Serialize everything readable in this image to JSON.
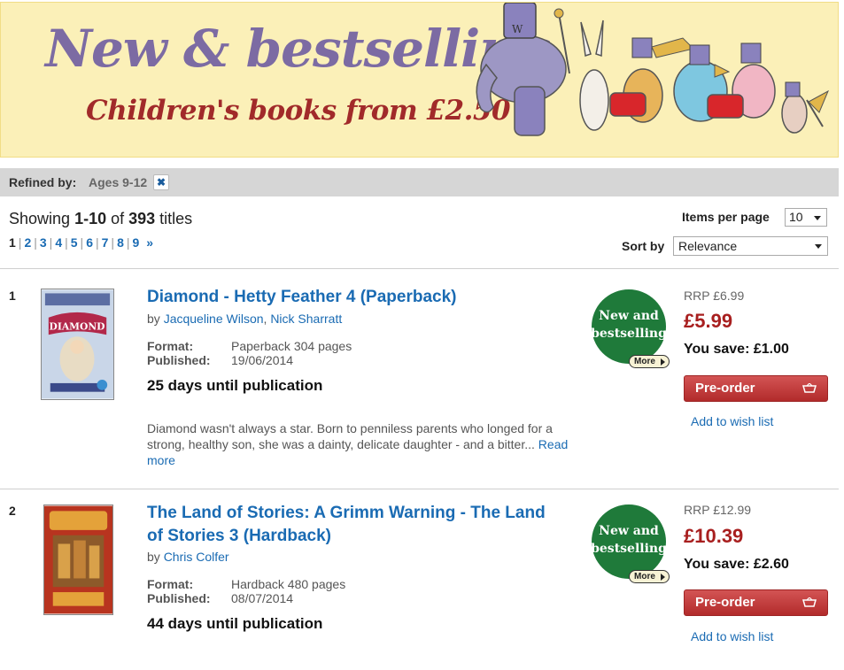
{
  "banner": {
    "title": "New & bestselling",
    "subtitle": "Children's books from £2.50"
  },
  "refine": {
    "label": "Refined by:",
    "value": "Ages 9-12",
    "remove_icon": "close-icon"
  },
  "results": {
    "showing_prefix": "Showing ",
    "range": "1-10",
    "of": " of ",
    "total": "393",
    "titles": " titles"
  },
  "pagination": {
    "pages": [
      "1",
      "2",
      "3",
      "4",
      "5",
      "6",
      "7",
      "8",
      "9"
    ],
    "current": "1",
    "next": "»"
  },
  "controls": {
    "items_per_page_label": "Items per page",
    "items_per_page_value": "10",
    "sort_label": "Sort by",
    "sort_value": "Relevance"
  },
  "items": [
    {
      "num": "1",
      "title": "Diamond - Hetty Feather 4 (Paperback)",
      "by": "by ",
      "author1": "Jacqueline Wilson",
      "sep": ", ",
      "author2": "Nick Sharratt",
      "format_label": "Format:",
      "format": "Paperback 304 pages",
      "published_label": "Published:",
      "published": "19/06/2014",
      "days": "25 days until publication",
      "desc": "Diamond wasn't always a star. Born to penniless parents who longed for a strong, healthy son, she was a dainty, delicate daughter - and a bitter... ",
      "read_more": "Read more",
      "badge_line1": "New and",
      "badge_line2": "bestselling",
      "badge_more": "More",
      "rrp": "RRP £6.99",
      "price": "£5.99",
      "save": "You save: £1.00",
      "button": "Pre-order",
      "wish": "Add to wish list"
    },
    {
      "num": "2",
      "title_line1": "The Land of Stories: A Grimm Warning - The Land",
      "title_line2": "of Stories 3 (Hardback)",
      "by": "by ",
      "author1": "Chris Colfer",
      "format_label": "Format:",
      "format": "Hardback 480 pages",
      "published_label": "Published:",
      "published": "08/07/2014",
      "days": "44 days until publication",
      "badge_line1": "New and",
      "badge_line2": "bestselling",
      "badge_more": "More",
      "rrp": "RRP £12.99",
      "price": "£10.39",
      "save": "You save: £2.60",
      "button": "Pre-order",
      "wish": "Add to wish list"
    }
  ],
  "colors": {
    "link": "#1a6bb3",
    "price": "#a81f1f",
    "button": "#b22b2b",
    "badge": "#1f7a3a",
    "banner_bg": "#fbf0b8"
  }
}
